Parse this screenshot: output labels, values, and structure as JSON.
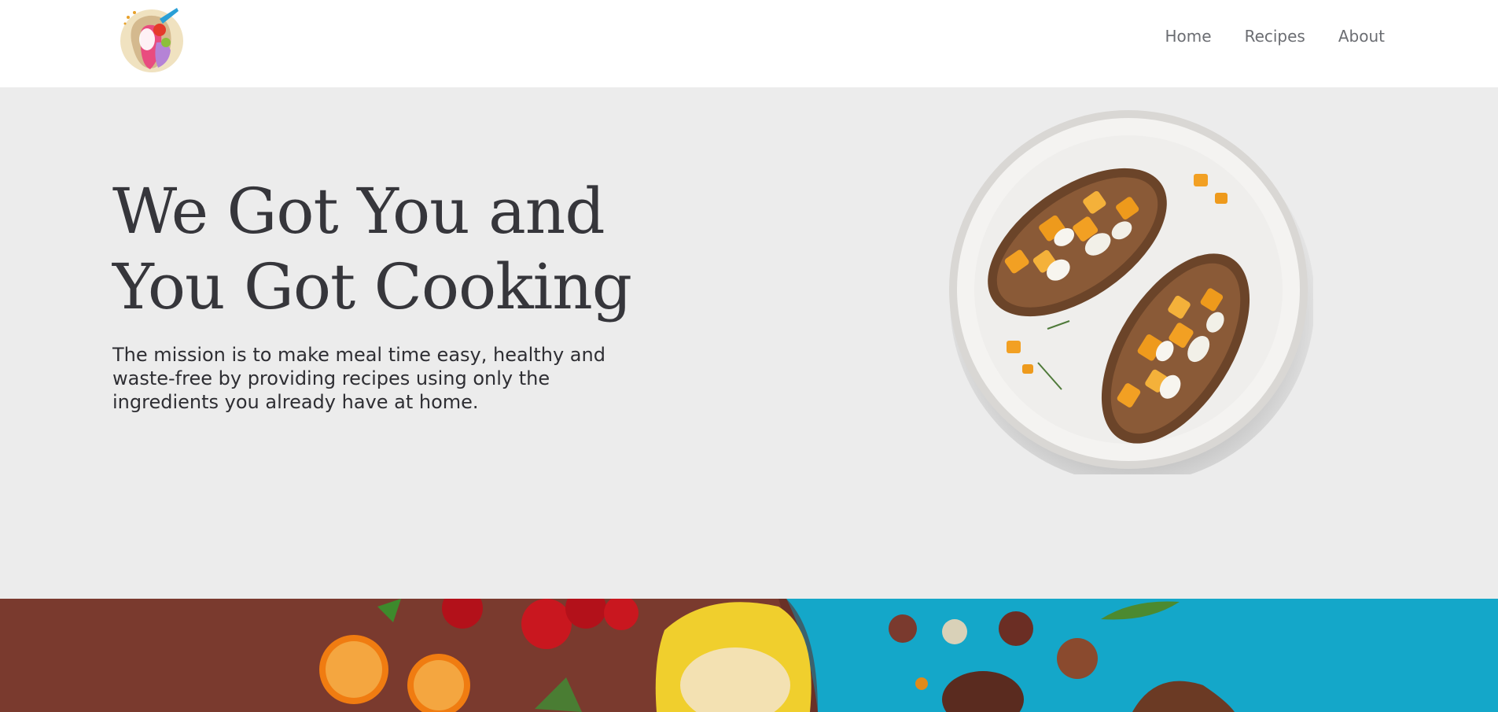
{
  "header": {
    "logo_icon": "chef-logo-icon",
    "nav": [
      {
        "label": "Home"
      },
      {
        "label": "Recipes"
      },
      {
        "label": "About"
      }
    ]
  },
  "hero": {
    "headline_line1": "We Got You and",
    "headline_line2": "You Got Cooking",
    "mission": "The mission is to make meal time easy, healthy and waste-free by providing recipes using only the ingredients you already have at home.",
    "image": "toast-plate-image"
  },
  "banner": {
    "image": "ingredients-banner-image"
  },
  "colors": {
    "hero_bg": "#ececec",
    "heading": "#36363b",
    "nav_text": "#6b6d72",
    "banner_brown": "#7a3a2e",
    "banner_blue": "#14a7c9"
  }
}
